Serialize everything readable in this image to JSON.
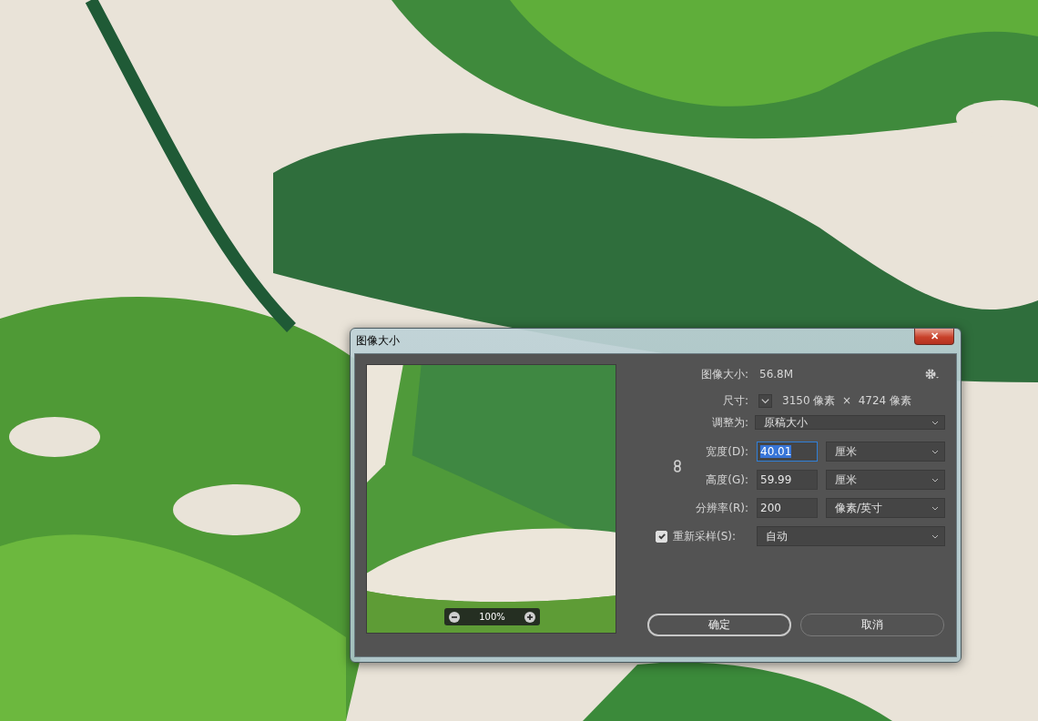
{
  "window": {
    "title": "图像大小",
    "close": "✕"
  },
  "preview": {
    "zoom": "100%"
  },
  "image_size": {
    "label": "图像大小:",
    "value": "56.8M"
  },
  "dimensions": {
    "label": "尺寸:",
    "value": "3150 像素  ×  4724 像素"
  },
  "fit_to": {
    "label": "调整为:",
    "value": "原稿大小"
  },
  "fields": [
    {
      "label": "宽度(D):",
      "value": "40.01",
      "unit": "厘米",
      "selected": true
    },
    {
      "label": "高度(G):",
      "value": "59.99",
      "unit": "厘米",
      "selected": false
    },
    {
      "label": "分辨率(R):",
      "value": "200",
      "unit": "像素/英寸",
      "selected": false
    }
  ],
  "resample": {
    "label": "重新采样(S):",
    "checked": true,
    "value": "自动"
  },
  "buttons": [
    {
      "label": "确定",
      "default": true
    },
    {
      "label": "取消",
      "default": false
    }
  ]
}
